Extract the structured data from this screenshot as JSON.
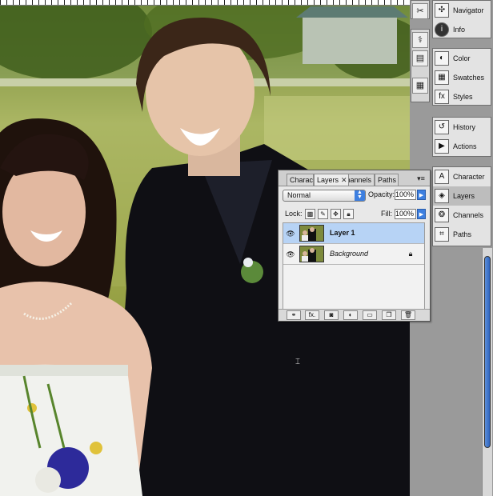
{
  "palette": {
    "tabs": [
      {
        "label": "Characte",
        "active": false
      },
      {
        "label": "Layers",
        "active": true
      },
      {
        "label": "Channels",
        "active": false
      },
      {
        "label": "Paths",
        "active": false
      }
    ],
    "close_glyph": "✕",
    "blend_mode": "Normal",
    "opacity_label": "Opacity:",
    "opacity_value": "100%",
    "lock_label": "Lock:",
    "fill_label": "Fill:",
    "fill_value": "100%",
    "layers": [
      {
        "name": "Layer 1",
        "selected": true,
        "visible": true,
        "locked": false,
        "style": "bold"
      },
      {
        "name": "Background",
        "selected": false,
        "visible": true,
        "locked": true,
        "style": "italic"
      }
    ],
    "footer_buttons": [
      "link-layers",
      "fx",
      "add-mask",
      "adjustment",
      "group",
      "new-layer",
      "delete"
    ],
    "fx_label": "fx."
  },
  "dock": {
    "group1": [
      {
        "label": "Navigator",
        "icon": "navigator-icon"
      },
      {
        "label": "Info",
        "icon": "info-icon"
      }
    ],
    "group2": [
      {
        "label": "Color",
        "icon": "color-icon"
      },
      {
        "label": "Swatches",
        "icon": "swatches-icon"
      },
      {
        "label": "Styles",
        "icon": "styles-icon"
      }
    ],
    "group3": [
      {
        "label": "History",
        "icon": "history-icon"
      },
      {
        "label": "Actions",
        "icon": "actions-icon"
      }
    ],
    "group4": [
      {
        "label": "Character",
        "icon": "character-icon"
      },
      {
        "label": "Layers",
        "icon": "layers-icon",
        "selected": true
      },
      {
        "label": "Channels",
        "icon": "channels-icon"
      },
      {
        "label": "Paths",
        "icon": "paths-icon"
      }
    ]
  },
  "colors": {
    "selection_blue": "#b7d3f5",
    "accent_blue": "#3d7fe0",
    "scroll_blue": "#2d63c0"
  }
}
